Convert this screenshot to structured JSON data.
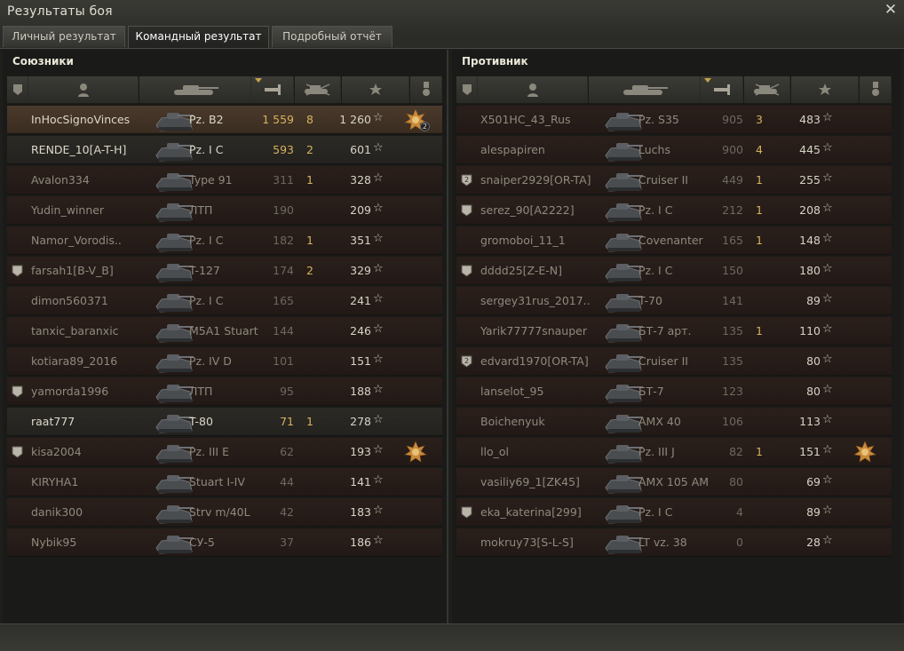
{
  "window": {
    "title": "Результаты боя"
  },
  "tabs": [
    {
      "label": "Личный результат",
      "active": false
    },
    {
      "label": "Командный результат",
      "active": true
    },
    {
      "label": "Подробный отчёт",
      "active": false
    }
  ],
  "allies": {
    "title": "Союзники",
    "rows": [
      {
        "platoon": "",
        "name": "InHocSignoVinces",
        "vehicle": "Pz. B2",
        "damage": "1 559",
        "kills": "8",
        "xp": "1 260",
        "medal": "medal-icon",
        "medal_count": "2",
        "alive": true,
        "highlight": "self"
      },
      {
        "platoon": "",
        "name": "RENDE_10[A-T-H]",
        "vehicle": "Pz. I C",
        "damage": "593",
        "kills": "2",
        "xp": "601",
        "medal": "",
        "medal_count": "",
        "alive": true,
        "highlight": "alive"
      },
      {
        "platoon": "",
        "name": "Avalon334",
        "vehicle": "Type 91",
        "damage": "311",
        "kills": "1",
        "xp": "328",
        "medal": "",
        "medal_count": "",
        "alive": false
      },
      {
        "platoon": "",
        "name": "Yudin_winner",
        "vehicle": "ЛТП",
        "damage": "190",
        "kills": "",
        "xp": "209",
        "medal": "",
        "medal_count": "",
        "alive": false
      },
      {
        "platoon": "",
        "name": "Namor_Vorodis..",
        "vehicle": "Pz. I C",
        "damage": "182",
        "kills": "1",
        "xp": "351",
        "medal": "",
        "medal_count": "",
        "alive": false
      },
      {
        "platoon": "1",
        "name": "farsah1[B-V_B]",
        "vehicle": "T-127",
        "damage": "174",
        "kills": "2",
        "xp": "329",
        "medal": "",
        "medal_count": "",
        "alive": false
      },
      {
        "platoon": "",
        "name": "dimon560371",
        "vehicle": "Pz. I C",
        "damage": "165",
        "kills": "",
        "xp": "241",
        "medal": "",
        "medal_count": "",
        "alive": false
      },
      {
        "platoon": "",
        "name": "tanxic_baranxic",
        "vehicle": "M5A1 Stuart",
        "damage": "144",
        "kills": "",
        "xp": "246",
        "medal": "",
        "medal_count": "",
        "alive": false
      },
      {
        "platoon": "",
        "name": "kotiara89_2016",
        "vehicle": "Pz. IV D",
        "damage": "101",
        "kills": "",
        "xp": "151",
        "medal": "",
        "medal_count": "",
        "alive": false
      },
      {
        "platoon": "1",
        "name": "yamorda1996",
        "vehicle": "ЛТП",
        "damage": "95",
        "kills": "",
        "xp": "188",
        "medal": "",
        "medal_count": "",
        "alive": false
      },
      {
        "platoon": "",
        "name": "raat777",
        "vehicle": "T-80",
        "damage": "71",
        "kills": "1",
        "xp": "278",
        "medal": "",
        "medal_count": "",
        "alive": true,
        "highlight": "alive"
      },
      {
        "platoon": "1",
        "name": "kisa2004",
        "vehicle": "Pz. III E",
        "damage": "62",
        "kills": "",
        "xp": "193",
        "medal": "medal-icon",
        "medal_count": "",
        "alive": false
      },
      {
        "platoon": "",
        "name": "KIRYHA1",
        "vehicle": "Stuart I-IV",
        "damage": "44",
        "kills": "",
        "xp": "141",
        "medal": "",
        "medal_count": "",
        "alive": false
      },
      {
        "platoon": "",
        "name": "danik300",
        "vehicle": "Strv m/40L",
        "damage": "42",
        "kills": "",
        "xp": "183",
        "medal": "",
        "medal_count": "",
        "alive": false
      },
      {
        "platoon": "",
        "name": "Nybik95",
        "vehicle": "СУ-5",
        "damage": "37",
        "kills": "",
        "xp": "186",
        "medal": "",
        "medal_count": "",
        "alive": false
      }
    ]
  },
  "enemies": {
    "title": "Противник",
    "rows": [
      {
        "platoon": "",
        "name": "X501HC_43_Rus",
        "vehicle": "Pz. S35",
        "damage": "905",
        "kills": "3",
        "xp": "483",
        "medal": "",
        "medal_count": "",
        "alive": false
      },
      {
        "platoon": "",
        "name": "alespapiren",
        "vehicle": "Luchs",
        "damage": "900",
        "kills": "4",
        "xp": "445",
        "medal": "",
        "medal_count": "",
        "alive": false
      },
      {
        "platoon": "2",
        "name": "snaiper2929[OR-TA]",
        "vehicle": "Cruiser II",
        "damage": "449",
        "kills": "1",
        "xp": "255",
        "medal": "",
        "medal_count": "",
        "alive": false
      },
      {
        "platoon": "1",
        "name": "serez_90[A2222]",
        "vehicle": "Pz. I C",
        "damage": "212",
        "kills": "1",
        "xp": "208",
        "medal": "",
        "medal_count": "",
        "alive": false
      },
      {
        "platoon": "",
        "name": "gromoboi_11_1",
        "vehicle": "Covenanter",
        "damage": "165",
        "kills": "1",
        "xp": "148",
        "medal": "",
        "medal_count": "",
        "alive": false
      },
      {
        "platoon": "1",
        "name": "dddd25[Z-E-N]",
        "vehicle": "Pz. I C",
        "damage": "150",
        "kills": "",
        "xp": "180",
        "medal": "",
        "medal_count": "",
        "alive": false
      },
      {
        "platoon": "",
        "name": "sergey31rus_2017..",
        "vehicle": "T-70",
        "damage": "141",
        "kills": "",
        "xp": "89",
        "medal": "",
        "medal_count": "",
        "alive": false
      },
      {
        "platoon": "",
        "name": "Yarik77777snauper",
        "vehicle": "БТ-7 арт.",
        "damage": "135",
        "kills": "1",
        "xp": "110",
        "medal": "",
        "medal_count": "",
        "alive": false
      },
      {
        "platoon": "2",
        "name": "edvard1970[OR-TA]",
        "vehicle": "Cruiser II",
        "damage": "135",
        "kills": "",
        "xp": "80",
        "medal": "",
        "medal_count": "",
        "alive": false
      },
      {
        "platoon": "",
        "name": "lanselot_95",
        "vehicle": "БТ-7",
        "damage": "123",
        "kills": "",
        "xp": "80",
        "medal": "",
        "medal_count": "",
        "alive": false
      },
      {
        "platoon": "",
        "name": "Boichenyuk",
        "vehicle": "AMX 40",
        "damage": "106",
        "kills": "",
        "xp": "113",
        "medal": "",
        "medal_count": "",
        "alive": false
      },
      {
        "platoon": "",
        "name": "llo_ol",
        "vehicle": "Pz. III J",
        "damage": "82",
        "kills": "1",
        "xp": "151",
        "medal": "medal-icon",
        "medal_count": "",
        "alive": false
      },
      {
        "platoon": "",
        "name": "vasiliy69_1[ZK45]",
        "vehicle": "AMX 105 AM",
        "damage": "80",
        "kills": "",
        "xp": "69",
        "medal": "",
        "medal_count": "",
        "alive": false
      },
      {
        "platoon": "1",
        "name": "eka_katerina[299]",
        "vehicle": "Pz. I C",
        "damage": "4",
        "kills": "",
        "xp": "89",
        "medal": "",
        "medal_count": "",
        "alive": false
      },
      {
        "platoon": "",
        "name": "mokruy73[S-L-S]",
        "vehicle": "LT vz. 38",
        "damage": "0",
        "kills": "",
        "xp": "28",
        "medal": "",
        "medal_count": "",
        "alive": false
      }
    ]
  },
  "columns": [
    {
      "icon": "platoon-icon"
    },
    {
      "icon": "player-icon"
    },
    {
      "icon": "tank-icon"
    },
    {
      "icon": "damage-icon",
      "sorted": true
    },
    {
      "icon": "kills-icon"
    },
    {
      "icon": "xp-star-icon"
    },
    {
      "icon": "medal-column-icon"
    }
  ],
  "colors": {
    "gold": "#d7b25e",
    "row_bg": "#241a17",
    "self_row_bg": "#4a3a2c"
  },
  "star_glyph": "☆"
}
